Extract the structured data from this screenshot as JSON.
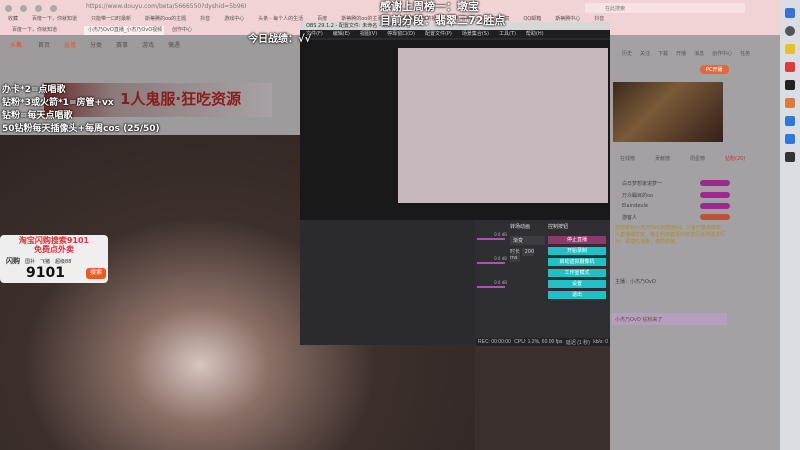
{
  "browser": {
    "url": "https://www.douyu.com/beta/5666550?dyshid=5b968eb-80253b432878aa2c67621d900061701",
    "bookmarks": [
      "收藏",
      "百度一下，你就知道",
      "只能带一口时最新",
      "斯蒂腾的oo的主题",
      "抖音",
      "游戏中心",
      "头条 - 每个人的生活",
      "百度",
      "斯蒂腾的oo的主页",
      "斯蒂腾新增加的视频",
      "吐嘈神器",
      "东方财富",
      "QQ邮箱",
      "斯蒂腾中心",
      "抖音"
    ],
    "tabs": [
      "百度一下，你就知道",
      "小杰乃OvO直播_小杰乃OvO视频",
      "创作中心"
    ],
    "search_placeholder": "在此搜索"
  },
  "douyu_left": {
    "logo": "斗鱼",
    "nav": [
      "首页",
      "直播",
      "分类",
      "赛事",
      "游戏",
      "偶遇"
    ],
    "banner": "1人鬼服·狂吃资源"
  },
  "obs": {
    "title": "OBS 29.1.2 - 配置文件: 未命名 - 场景: 未命名",
    "menu": [
      "文件(F)",
      "编辑(E)",
      "视图(V)",
      "停靠窗口(D)",
      "配置文件(P)",
      "场景集合(S)",
      "工具(T)",
      "帮助(H)"
    ],
    "transitions_title": "转场动画",
    "transition": "渐变",
    "duration_label": "时长",
    "duration": "200 ms",
    "controls_title": "控制按钮",
    "buttons": [
      "停止直播",
      "开始录制",
      "启动虚拟摄像机",
      "工作室模式",
      "设置",
      "退出"
    ],
    "audio_db": [
      "0.0 dB",
      "0.0 dB",
      "0.0 dB"
    ],
    "status": [
      "REC: 00:00:00",
      "CPU: 1.2%, 60.00 fps",
      "延迟 (1 秒)",
      "kb/s: 0"
    ]
  },
  "douyu_right": {
    "top_icons": [
      "历史",
      "关注",
      "下载",
      "开播",
      "消息",
      "创作中心",
      "任务"
    ],
    "pc_live": "PC开播",
    "rank_tabs": [
      "在线榜",
      "贡献榜",
      "周星榜",
      "钻粉(20)"
    ],
    "rank_rows": [
      "白日梦想家追梦一",
      "万众瞩目的oo",
      "Elaindeule",
      "游客人"
    ],
    "description": "欢迎来到小杰乃OvO的直播间。斗鱼严禁未成年人直播或打赏，禁止利用直播内容进行任何违法行为。请理性消费，谨防诈骗。",
    "anchor_label": "主播：小杰乃OvO",
    "chat": "小杰乃OvO 钻粉来了"
  },
  "overlay": {
    "thanks_line1": "感谢上周榜一：墩宝",
    "thanks_line2": "目前分段：翡翠二72胜点",
    "today": "今日战绩：√√",
    "rules": [
      "办卡*2=点唱歌",
      "钻粉*3或火箭*1=房管+vx",
      "钻粉=每天点唱歌",
      "50钻粉每天插像头+每周cos (25/50)"
    ]
  },
  "taobao": {
    "title1": "淘宝闪购搜索9101",
    "title2": "免费点外卖",
    "tags": [
      "闪购",
      "国补",
      "飞猪",
      "超级88"
    ],
    "number": "9101",
    "search": "搜索"
  },
  "colors": {
    "accent": "#1fc0c8",
    "stop": "#8c3a6e",
    "douyu": "#e8582c"
  }
}
